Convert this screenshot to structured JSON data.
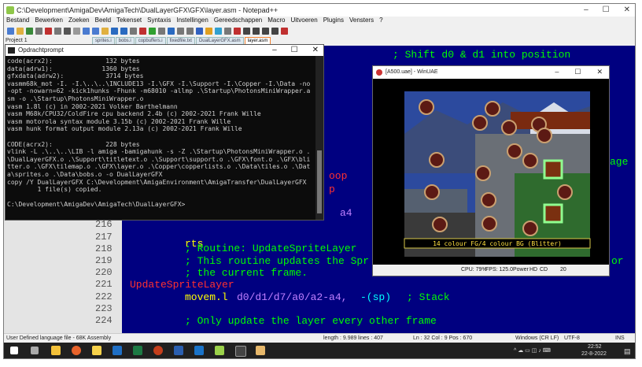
{
  "npp": {
    "title": "C:\\Development\\AmigaDev\\AmigaTech\\DualLayerGFX\\GFX\\layer.asm - Notepad++",
    "menu": [
      "Bestand",
      "Bewerken",
      "Zoeken",
      "Beeld",
      "Tekenset",
      "Syntaxis",
      "Instellingen",
      "Gereedschappen",
      "Macro",
      "Uitvoeren",
      "Plugins",
      "Vensters",
      "?"
    ],
    "project_label": "Project 1",
    "tabs": [
      "sprites.i",
      "bobs.i",
      "copbuffers.i",
      "fixedfile.txt",
      "DualLayerGFX.asm",
      "layer.asm"
    ],
    "active_tab": "layer.asm",
    "line_numbers": [
      "216",
      "217",
      "218",
      "219",
      "220",
      "221",
      "222",
      "223",
      "224"
    ],
    "code": {
      "top_comment": "; Shift d0 & d1 into position",
      "right_fragment": "age",
      "frag_oop": "oop",
      "frag_p": "p",
      "frag_a4": "a4",
      "rts": "rts",
      "routine_comment": "; Routine: UpdateSpriteLayer",
      "desc1_comment": "; This routine updates the Spr",
      "desc1_tail": "or",
      "desc2_comment": "; the current frame.",
      "label": "UpdateSpriteLayer",
      "movem_instr": "movem.l",
      "movem_regs": "d0/d1/d7/a0/a2-a4,",
      "movem_sp": "-(sp)",
      "movem_comment": "; Stack",
      "last_comment": "; Only update the layer every other frame"
    },
    "status": {
      "lang": "User Defined language file - 68K Assembly",
      "length": "length : 9.989",
      "lines": "lines : 407",
      "pos": "Ln : 32   Col : 9   Pos : 670",
      "eol": "Windows (CR LF)",
      "enc": "UTF-8",
      "ins": "INS"
    }
  },
  "cmd": {
    "title": "Opdrachtprompt",
    "lines": [
      "code(acrx2):              132 bytes",
      "data(adrw1):             1360 bytes",
      "gfxdata(adrw2):           3714 bytes",
      "vasmm68k_mot -I. -I.\\..\\..\\INCLUDE13 -I.\\GFX -I.\\Support -I.\\Copper -I.\\Data -no",
      "-opt -nowarn=62 -kick1hunks -Fhunk -m68010 -allmp .\\Startup\\PhotonsMiniWrapper.a",
      "sm -o .\\Startup\\PhotonsMiniWrapper.o",
      "vasm 1.8l (c) in 2002-2021 Volker Barthelmann",
      "vasm M68k/CPU32/ColdFire cpu backend 2.4b (c) 2002-2021 Frank Wille",
      "vasm motorola syntax module 3.15b (c) 2002-2021 Frank Wille",
      "vasm hunk format output module 2.13a (c) 2002-2021 Frank Wille",
      "",
      "CODE(acrx2):              228 bytes",
      "vlink -L .\\..\\..\\LIB -l amiga -bamigahunk -s -Z .\\Startup\\PhotonsMiniWrapper.o .",
      "\\DualLayerGFX.o .\\Support\\titletext.o .\\Support\\support.o .\\GFX\\font.o .\\GFX\\bli",
      "tter.o .\\GFX\\tilemap.o .\\GFX\\layer.o .\\Copper\\copperlists.o .\\Data\\tiles.o .\\Dat",
      "a\\sprites.o .\\Data\\bobs.o -o DualLayerGFX",
      "copy /Y DualLayerGFX C:\\Development\\AmigaEnvironment\\AmigaTransfer\\DualLayerGFX",
      "        1 file(s) copied.",
      "",
      "C:\\Development\\AmigaDev\\AmigaTech\\DualLayerGFX>"
    ]
  },
  "uae": {
    "title": "[A500.uae] - WinUAE",
    "banner": "14 colour FG/4 colour BG (Blitter)",
    "status": {
      "cpu": "CPU: 79%",
      "fps": "FPS: 125.0",
      "power": "Power",
      "hd": "HD",
      "cd": "CD",
      "num": "20"
    }
  },
  "taskbar": {
    "time": "22:52",
    "date": "22-8-2022"
  },
  "colors": {
    "editor_bg": "#000080",
    "comment": "#00ff00",
    "label": "#ff3030",
    "instruction": "#ffff00",
    "register": "#c080ff",
    "operand": "#00ffff"
  }
}
